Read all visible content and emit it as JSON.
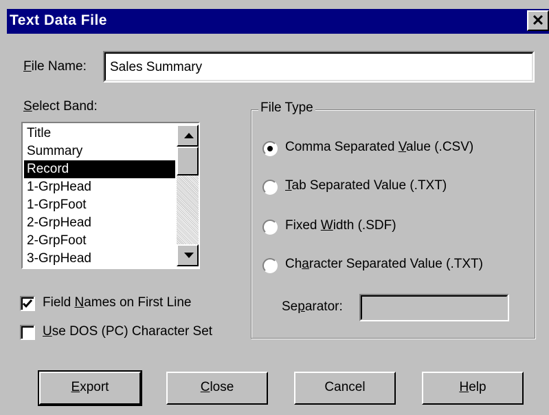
{
  "window": {
    "title": "Text Data File",
    "close_label": "✕"
  },
  "file_name": {
    "label_u": "F",
    "label_rest": "ile Name:",
    "value": "Sales Summary"
  },
  "select_band": {
    "label_u": "S",
    "label_rest": "elect Band:",
    "items": [
      "Title",
      "Summary",
      "Record",
      "1-GrpHead",
      "1-GrpFoot",
      "2-GrpHead",
      "2-GrpFoot",
      "3-GrpHead"
    ],
    "selected": "Record"
  },
  "options": {
    "field_names": {
      "pre": "Field ",
      "u": "N",
      "post": "ames on First Line",
      "checked": true
    },
    "dos_charset": {
      "pre": "",
      "u": "U",
      "post": "se DOS (PC) Character Set",
      "checked": false
    }
  },
  "file_type": {
    "legend": "File Type",
    "radios": [
      {
        "pre": "Comma Separated ",
        "u": "V",
        "post": "alue (.CSV)",
        "selected": true
      },
      {
        "pre": "",
        "u": "T",
        "post": "ab Separated Value (.TXT)",
        "selected": false
      },
      {
        "pre": "Fixed ",
        "u": "W",
        "post": "idth (.SDF)",
        "selected": false
      },
      {
        "pre": "Ch",
        "u": "a",
        "post": "racter Separated Value (.TXT)",
        "selected": false
      }
    ],
    "separator": {
      "pre": "Se",
      "u": "p",
      "post": "arator:",
      "value": ""
    }
  },
  "buttons": [
    {
      "u": "E",
      "post": "xport"
    },
    {
      "u": "C",
      "post": "lose"
    },
    {
      "u": "",
      "post": "Cancel"
    },
    {
      "u": "H",
      "post": "elp"
    }
  ],
  "colors": {
    "titlebar": "#000080",
    "face": "#c0c0c0",
    "selection": "#000000"
  }
}
